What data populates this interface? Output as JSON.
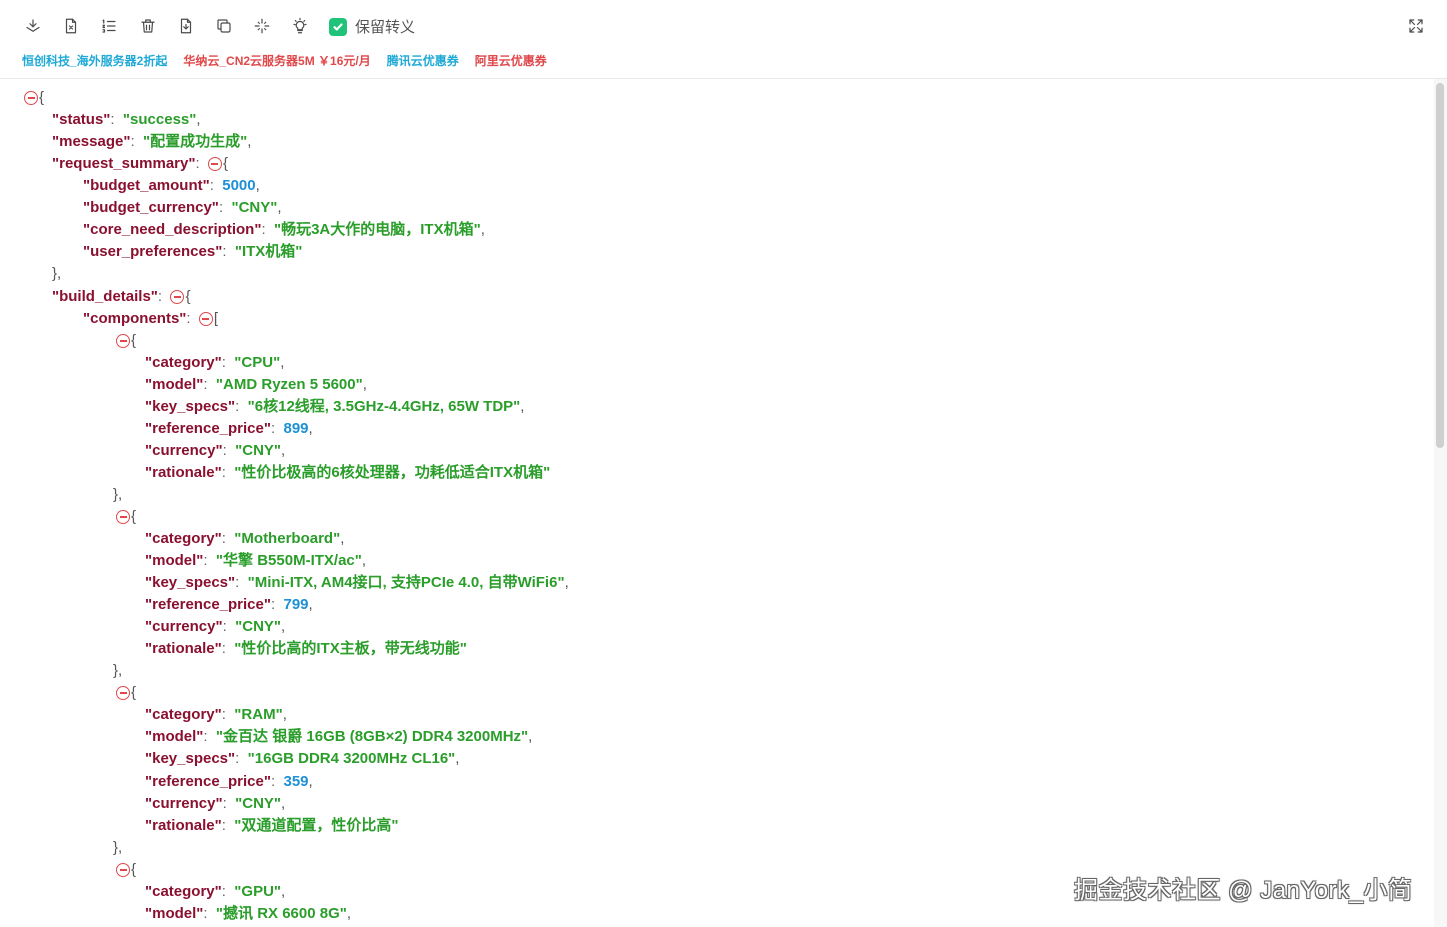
{
  "toolbar": {
    "icons": [
      "layers-icon",
      "file-x-icon",
      "list-ordered-icon",
      "trash-icon",
      "file-download-icon",
      "copy-icon",
      "sparkle-icon",
      "lightbulb-icon"
    ],
    "checkbox_label": "保留转义",
    "checkbox_checked": true,
    "expand_icon": "fullscreen-icon"
  },
  "ads": [
    {
      "label": "恒创科技_海外服务器2折起"
    },
    {
      "label": "华纳云_CN2云服务器5M ￥16元/月"
    },
    {
      "label": "腾讯云优惠券"
    },
    {
      "label": "阿里云优惠券"
    }
  ],
  "json": {
    "status": "success",
    "message": "配置成功生成",
    "request_summary": {
      "budget_amount": "5000",
      "budget_currency": "CNY",
      "core_need_description": "畅玩3A大作的电脑，ITX机箱",
      "user_preferences": "ITX机箱"
    },
    "components": [
      {
        "category": "CPU",
        "model": "AMD Ryzen 5 5600",
        "key_specs": "6核12线程, 3.5GHz-4.4GHz, 65W TDP",
        "reference_price": "899",
        "currency": "CNY",
        "rationale": "性价比极高的6核处理器，功耗低适合ITX机箱"
      },
      {
        "category": "Motherboard",
        "model": "华擎 B550M-ITX/ac",
        "key_specs": "Mini-ITX, AM4接口, 支持PCIe 4.0, 自带WiFi6",
        "reference_price": "799",
        "currency": "CNY",
        "rationale": "性价比高的ITX主板，带无线功能"
      },
      {
        "category": "RAM",
        "model": "金百达 银爵 16GB (8GB×2) DDR4 3200MHz",
        "key_specs": "16GB DDR4 3200MHz CL16",
        "reference_price": "359",
        "currency": "CNY",
        "rationale": "双通道配置，性价比高"
      },
      {
        "category": "GPU",
        "model": "撼讯 RX 6600 8G"
      }
    ]
  },
  "watermark": "掘金技术社区 @ JanYork_小简"
}
